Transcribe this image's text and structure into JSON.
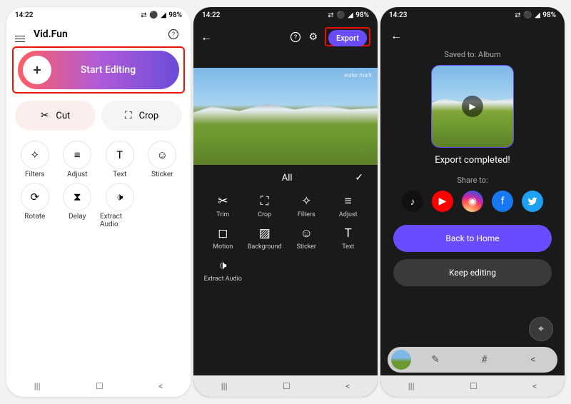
{
  "status": {
    "time1": "14:22",
    "time2": "14:22",
    "time3": "14:23",
    "icons1": "⬚ ⬚ ▪",
    "icons2": "⬚",
    "battery": "98%",
    "signal": "◢"
  },
  "phone1": {
    "app_title": "Vid.Fun",
    "start_label": "Start Editing",
    "quick": {
      "cut": "Cut",
      "crop": "Crop"
    },
    "tools": {
      "filters": "Filters",
      "adjust": "Adjust",
      "text": "Text",
      "sticker": "Sticker",
      "rotate": "Rotate",
      "delay": "Delay",
      "extract": "Extract Audio"
    }
  },
  "phone2": {
    "export": "Export",
    "watermark": "water mark",
    "tab_all": "All",
    "tools": {
      "trim": "Trim",
      "crop": "Crop",
      "filters": "Filters",
      "adjust": "Adjust",
      "motion": "Motion",
      "background": "Background",
      "sticker": "Sticker",
      "text": "Text",
      "extract": "Extract Audio"
    }
  },
  "phone3": {
    "saved_to": "Saved to: Album",
    "complete": "Export completed!",
    "share_to": "Share to:",
    "back_home": "Back to Home",
    "keep_editing": "Keep editing"
  }
}
